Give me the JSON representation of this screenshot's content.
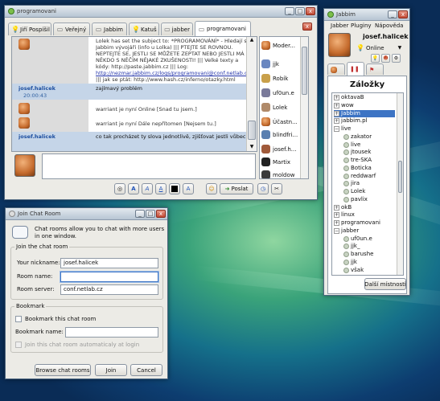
{
  "chat_window": {
    "title": "programovani",
    "tabs": [
      {
        "label": "Jiří Pospíšil"
      },
      {
        "label": "Veřejný"
      },
      {
        "label": "Jabbim"
      },
      {
        "label": "Katuš"
      },
      {
        "label": "jabber"
      },
      {
        "label": "programovani"
      }
    ],
    "messages": [
      {
        "lines": [
          "Lolek has set the subject to: *PROGRAMOVÁNÍ* - Hledají se",
          "Jabbim vývojáři (info u Lolka) ||| PTEJTE SE ROVNOU.",
          "NEPTEJTE SE, JESTLI SE MŮŽETE ZEPTAT NEBO JESTLI MÁ",
          "NĚKDO S NĚČÍM NĚJAKÉ ZKUŠENOSTI! ||| Velké texty a",
          "kódy: http://paste.jabbim.cz ||| Log:",
          "http://nezmar.jabbim.cz/logs/programovani@conf.netlab.cz/",
          "||| jak se ptát: http://www.hash.cz/inferno/otazky.html"
        ]
      },
      {
        "nick": "josef.halicek",
        "time": "20:00:43",
        "text": "zajímavý problém"
      },
      {
        "text": "warriant je nyní Online [Snad tu jsem.]"
      },
      {
        "text": "warriant je nyní Dále nepřítomen [Nejsem tu.]"
      },
      {
        "nick": "josef.halicek",
        "text": "co tak procházet ty slova jednotlivě, zjišťovat jestli vůbec"
      }
    ],
    "occupants": [
      "Moder...",
      "jjk",
      "Robík",
      "uf0un.e",
      "Lolek",
      "Účastn...",
      "blindfri...",
      "josef.h...",
      "Martix",
      "moldow"
    ],
    "toolbar_icons": [
      "clear-icon",
      "bold-icon",
      "italic-icon",
      "underline-icon",
      "color-icon",
      "font-icon",
      "smiley-icon",
      "send-icon",
      "history-icon",
      "settings-icon"
    ],
    "send_label": "Poslat"
  },
  "roster": {
    "title": "Jabbim",
    "menu": [
      "Jabber",
      "Pluginy",
      "Nápověda"
    ],
    "user": "josef.halicek",
    "status": "Online",
    "heading": "Záložky",
    "tree": [
      {
        "label": "oktavaB",
        "kind": "group",
        "open": false,
        "level": 0
      },
      {
        "label": "wow",
        "kind": "group",
        "open": false,
        "level": 0
      },
      {
        "label": "Jabbim",
        "kind": "group",
        "open": false,
        "level": 0,
        "selected": true
      },
      {
        "label": "jabbim.pl",
        "kind": "group",
        "open": false,
        "level": 0
      },
      {
        "label": "live",
        "kind": "group",
        "open": true,
        "level": 0
      },
      {
        "label": "zakator",
        "kind": "user",
        "level": 1
      },
      {
        "label": "live",
        "kind": "user",
        "level": 1
      },
      {
        "label": "jtousek",
        "kind": "user",
        "level": 1
      },
      {
        "label": "tre-SKA",
        "kind": "user",
        "level": 1
      },
      {
        "label": "Boticka",
        "kind": "user",
        "level": 1
      },
      {
        "label": "reddwarf",
        "kind": "user",
        "level": 1
      },
      {
        "label": "jira",
        "kind": "user",
        "level": 1
      },
      {
        "label": "Lolek",
        "kind": "user",
        "level": 1
      },
      {
        "label": "pavlix",
        "kind": "user",
        "level": 1
      },
      {
        "label": "okB",
        "kind": "group",
        "open": false,
        "level": 0
      },
      {
        "label": "linux",
        "kind": "group",
        "open": false,
        "level": 0
      },
      {
        "label": "programovani",
        "kind": "group",
        "open": false,
        "level": 0
      },
      {
        "label": "jabber",
        "kind": "group",
        "open": true,
        "level": 0
      },
      {
        "label": "uf0un.e",
        "kind": "user",
        "level": 1
      },
      {
        "label": "jjk_",
        "kind": "user",
        "level": 1
      },
      {
        "label": "barushe",
        "kind": "user",
        "level": 1
      },
      {
        "label": "jjk",
        "kind": "user",
        "level": 1
      },
      {
        "label": "však",
        "kind": "user",
        "level": 1
      }
    ],
    "more_rooms_button": "Další místnosti"
  },
  "join_dialog": {
    "title": "Join Chat Room",
    "intro": [
      "Chat rooms allow you to chat with more users",
      "in one window."
    ],
    "section_join": "Join the chat room",
    "nickname_label": "Your nickname:",
    "nickname_value": "josef.halicek",
    "room_label": "Room name:",
    "room_value": "",
    "server_label": "Room server:",
    "server_value": "conf.netlab.cz",
    "section_bookmark": "Bookmark",
    "bookmark_checkbox": "Bookmark this chat room",
    "bookmark_name_label": "Bookmark name:",
    "bookmark_name_value": "",
    "autojoin_checkbox": "Join this chat room automaticaly at login",
    "browse_button": "Browse chat rooms",
    "join_button": "Join",
    "cancel_button": "Cancel"
  }
}
